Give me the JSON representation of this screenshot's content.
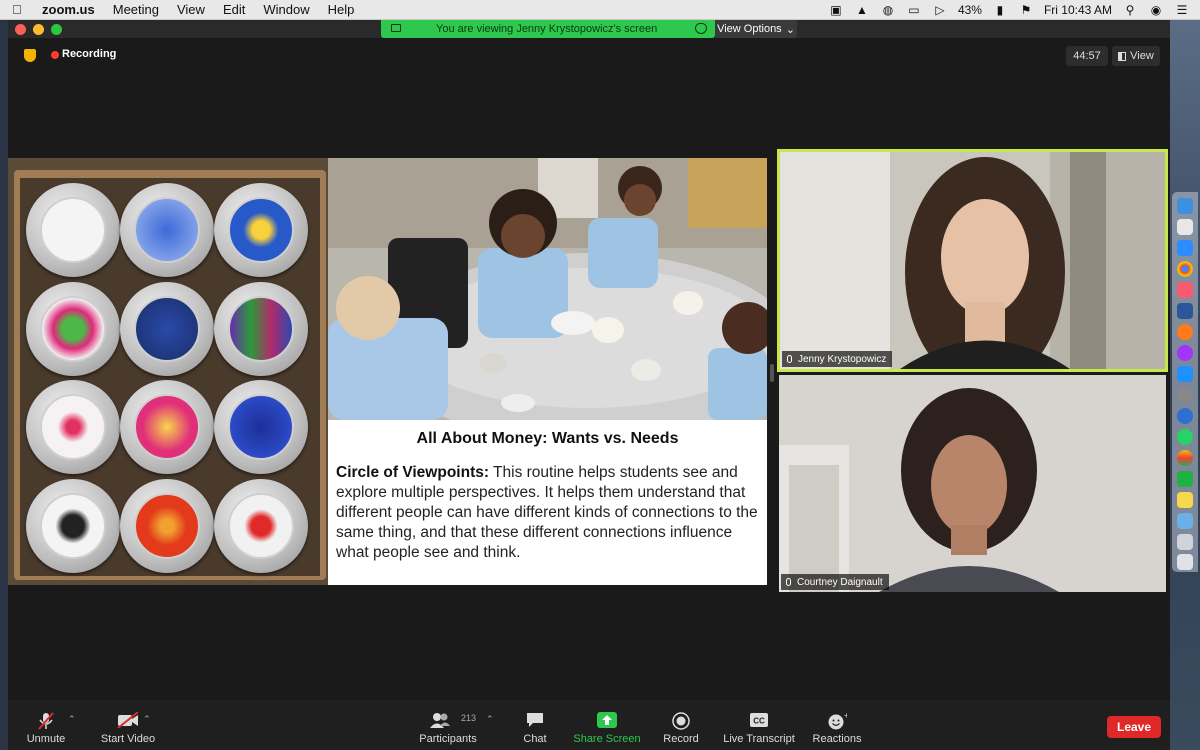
{
  "menubar": {
    "app_name": "zoom.us",
    "menus": [
      "Meeting",
      "View",
      "Edit",
      "Window",
      "Help"
    ],
    "battery": "43%",
    "clock": "Fri 10:43 AM"
  },
  "share_banner": {
    "text": "You are viewing Jenny Krystopowicz's screen",
    "view_options": "View Options"
  },
  "topbar": {
    "recording_label": "Recording",
    "timer": "44:57",
    "view_label": "View"
  },
  "slide": {
    "title": "All About Money: Wants vs. Needs",
    "body_bold": "Circle of Viewpoints:",
    "body_text": " This routine helps students see and explore multiple perspectives. It helps them understand that different people can have different kinds of connections to the same thing, and that these different connections influence what people see and think."
  },
  "participants": [
    {
      "name": "Jenny Krystopowicz",
      "active_speaker": true
    },
    {
      "name": "Courtney Daignault",
      "active_speaker": false
    }
  ],
  "toolbar": {
    "unmute": "Unmute",
    "start_video": "Start Video",
    "participants": "Participants",
    "participant_count": "213",
    "chat": "Chat",
    "share_screen": "Share Screen",
    "record": "Record",
    "live_transcript": "Live Transcript",
    "reactions": "Reactions",
    "leave": "Leave"
  },
  "colors": {
    "share_green": "#2dc84d",
    "leave_red": "#e02828",
    "active_speaker_border": "#c6e84a",
    "recording_red": "#ff3b30"
  }
}
